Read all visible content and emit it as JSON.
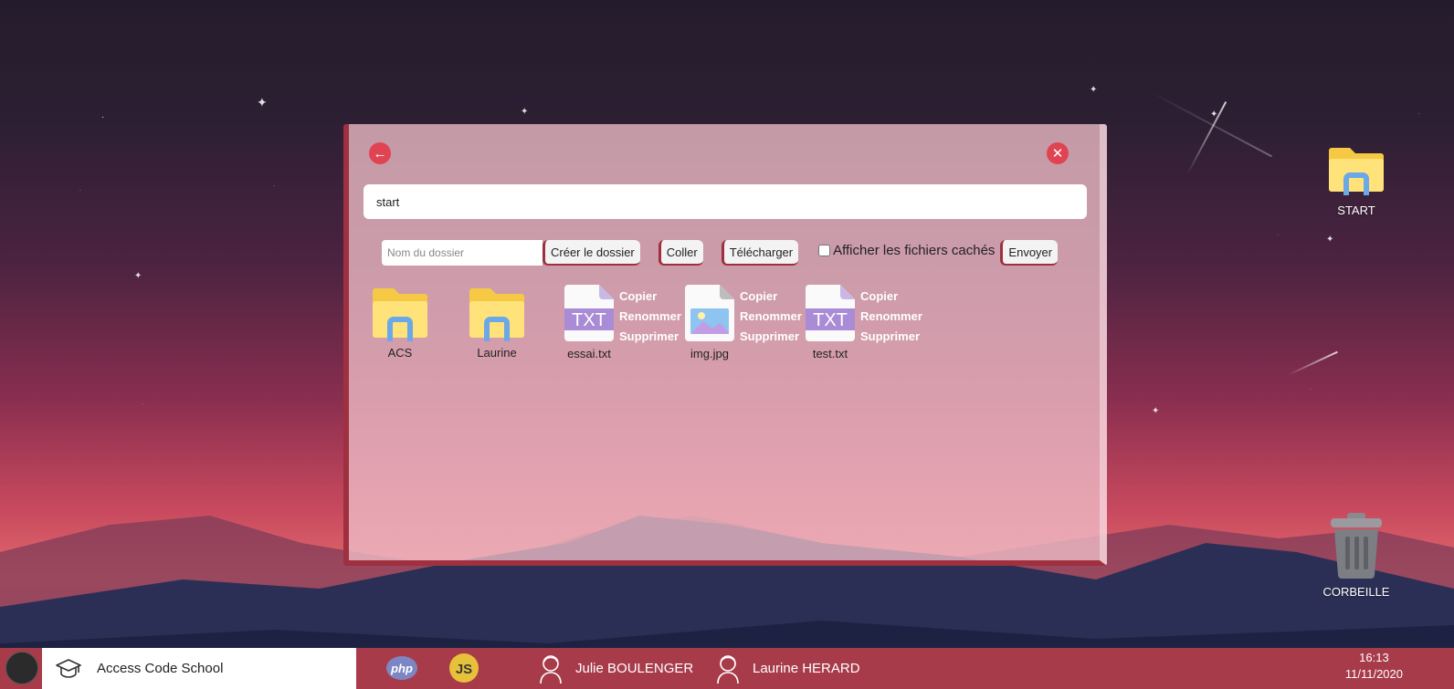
{
  "desktop": {
    "icons": [
      {
        "label": "START",
        "icon": "folder-icon"
      },
      {
        "label": "CORBEILLE",
        "icon": "trash-icon"
      }
    ]
  },
  "window": {
    "back_icon": "arrow-left-icon",
    "close_icon": "close-icon",
    "path": "start",
    "toolbar": {
      "folder_name_placeholder": "Nom du dossier",
      "create_folder": "Créer le dossier",
      "paste": "Coller",
      "upload": "Télécharger",
      "show_hidden": "Afficher les fichiers cachés",
      "show_hidden_checked": false,
      "send": "Envoyer"
    },
    "folders": [
      {
        "name": "ACS"
      },
      {
        "name": "Laurine"
      }
    ],
    "files": [
      {
        "name": "essai.txt",
        "type": "txt",
        "actions": [
          "Copier",
          "Renommer",
          "Supprimer"
        ]
      },
      {
        "name": "img.jpg",
        "type": "image",
        "actions": [
          "Copier",
          "Renommer",
          "Supprimer"
        ]
      },
      {
        "name": "test.txt",
        "type": "txt",
        "actions": [
          "Copier",
          "Renommer",
          "Supprimer"
        ]
      }
    ],
    "txt_badge": "TXT"
  },
  "taskbar": {
    "school": "Access Code School",
    "apps": [
      {
        "name": "php",
        "label": "php"
      },
      {
        "name": "js",
        "label": "JS"
      }
    ],
    "users": [
      {
        "name": "Julie BOULENGER"
      },
      {
        "name": "Laurine HERARD"
      }
    ],
    "clock": {
      "time": "16:13",
      "date": "11/11/2020"
    }
  },
  "colors": {
    "accent": "#a83b4a",
    "window_bg": "#f0bec8",
    "close": "#e04452"
  }
}
